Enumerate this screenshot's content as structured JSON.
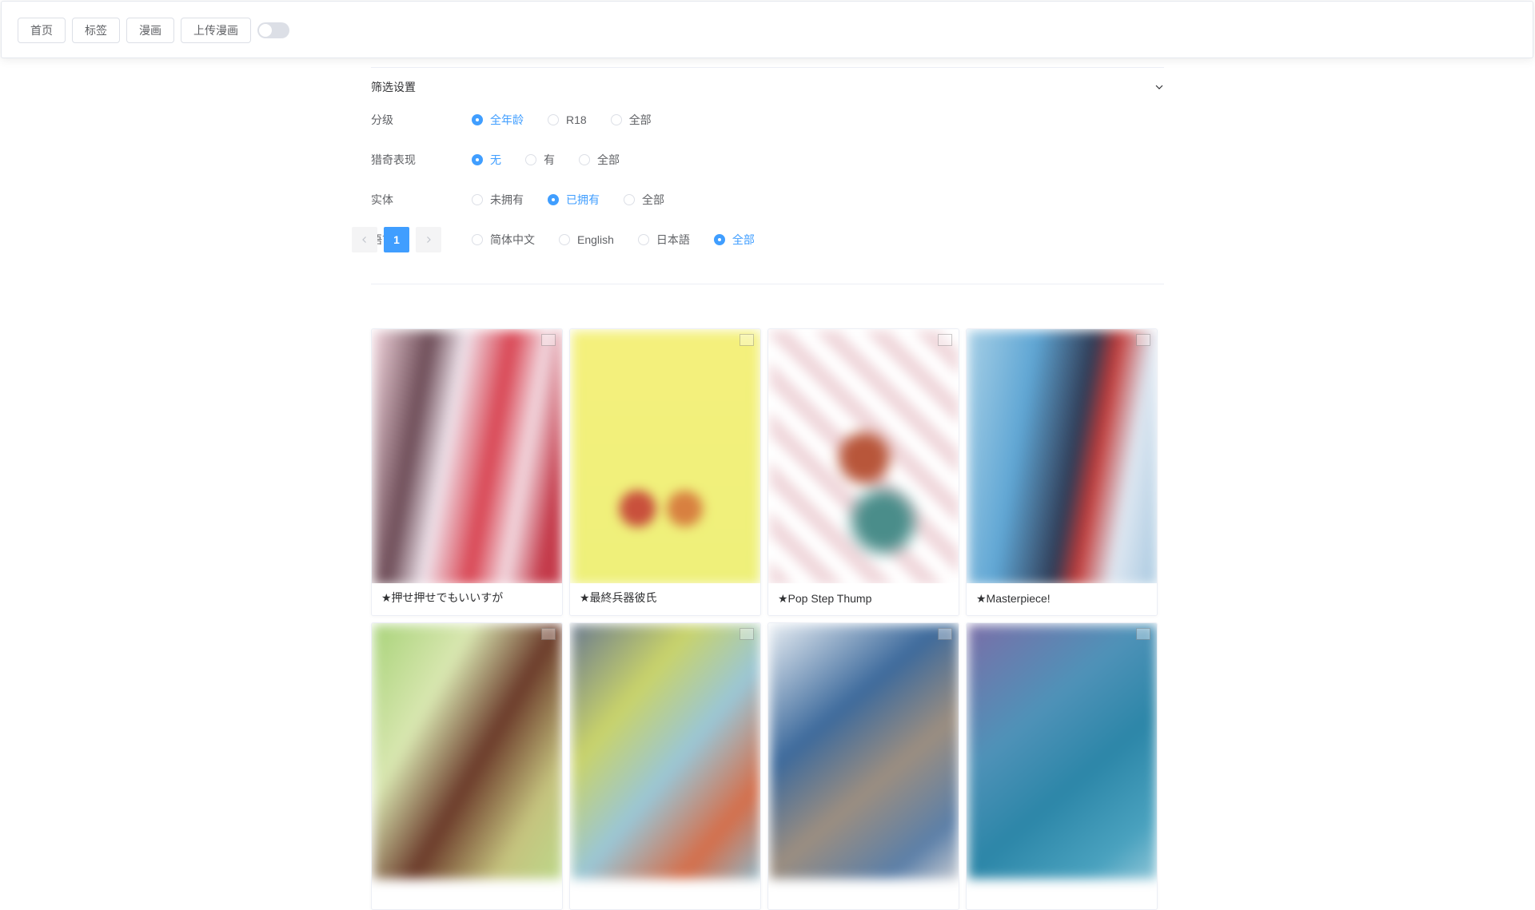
{
  "nav": {
    "items": [
      "首页",
      "标签",
      "漫画",
      "上传漫画"
    ],
    "toggle_on": false
  },
  "filters": {
    "title": "筛选设置",
    "rows": [
      {
        "label": "分级",
        "options": [
          "全年龄",
          "R18",
          "全部"
        ],
        "selected": 0
      },
      {
        "label": "猎奇表现",
        "options": [
          "无",
          "有",
          "全部"
        ],
        "selected": 0
      },
      {
        "label": "实体",
        "options": [
          "未拥有",
          "已拥有",
          "全部"
        ],
        "selected": 1
      },
      {
        "label": "语言",
        "options": [
          "简体中文",
          "English",
          "日本語",
          "全部"
        ],
        "selected": 3
      }
    ]
  },
  "pagination": {
    "prev_icon": "chevron-left-icon",
    "current": "1",
    "next_icon": "chevron-right-icon"
  },
  "comics": [
    {
      "title": "★押せ押せでもいいすが"
    },
    {
      "title": "★最終兵器彼氏"
    },
    {
      "title": "★Pop Step Thump"
    },
    {
      "title": "★Masterpiece!"
    },
    {
      "title": ""
    },
    {
      "title": ""
    },
    {
      "title": ""
    },
    {
      "title": ""
    }
  ],
  "colors": {
    "accent": "#409eff"
  }
}
